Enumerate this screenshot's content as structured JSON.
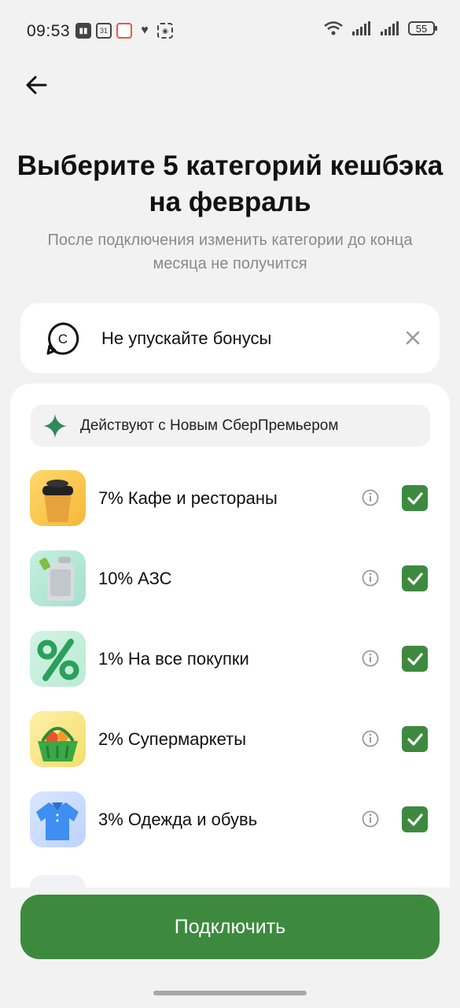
{
  "status_bar": {
    "time": "09:53",
    "calendar_day": "31",
    "battery": "55"
  },
  "header": {
    "title": "Выберите 5 категорий кешбэка на февраль",
    "subtitle": "После подключения изменить категории до конца месяца не получится"
  },
  "bonus_banner": {
    "text": "Не упускайте бонусы",
    "icon": "sber-spasibo-icon"
  },
  "premier": {
    "text": "Действуют с Новым СберПремьером"
  },
  "categories": [
    {
      "label": "7% Кафе и рестораны",
      "icon": "coffee-cup-icon",
      "checked": true
    },
    {
      "label": "10% АЗС",
      "icon": "fuel-canister-icon",
      "checked": true
    },
    {
      "label": "1% На все покупки",
      "icon": "percent-icon",
      "checked": true
    },
    {
      "label": "2% Супермаркеты",
      "icon": "grocery-basket-icon",
      "checked": true
    },
    {
      "label": "3% Одежда и обувь",
      "icon": "shirt-icon",
      "checked": true
    }
  ],
  "cta": {
    "label": "Подключить"
  },
  "colors": {
    "accent": "#3d8a3f",
    "background": "#f2f2f2",
    "card": "#ffffff"
  }
}
